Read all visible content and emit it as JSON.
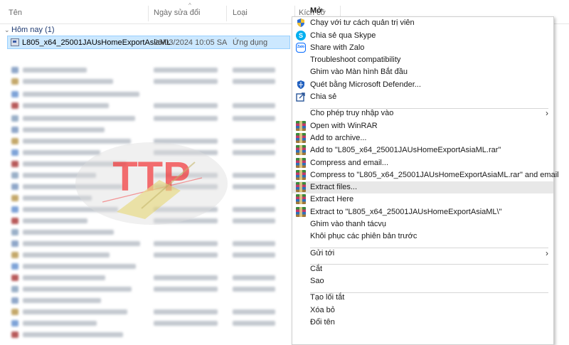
{
  "explorer": {
    "columns": [
      "Tên",
      "Ngày sửa đổi",
      "Loại",
      "Kích cỡ"
    ],
    "group_label": "Hôm nay (1)",
    "selected_file": {
      "name": "L805_x64_25001JAUsHomeExportAsiaML",
      "date": "26/03/2024 10:05 SA",
      "type": "Ứng dụng"
    }
  },
  "watermark": {
    "text": "TTP"
  },
  "context_menu": {
    "items": [
      {
        "label": "Mở",
        "icon": "none",
        "bold": true
      },
      {
        "label": "Chạy với tư cách quản trị viên",
        "icon": "uac-shield-icon"
      },
      {
        "label": "Chia sẻ qua Skype",
        "icon": "skype-icon"
      },
      {
        "label": "Share with Zalo",
        "icon": "zalo-icon"
      },
      {
        "label": "Troubleshoot compatibility",
        "icon": "none"
      },
      {
        "label": "Ghim vào Màn hình Bắt đầu",
        "icon": "none"
      },
      {
        "label": "Quét bằng Microsoft Defender...",
        "icon": "defender-icon"
      },
      {
        "label": "Chia sẻ",
        "icon": "share-icon"
      },
      {
        "label": "Cho phép truy nhập vào",
        "icon": "none",
        "submenu": true
      },
      {
        "label": "Open with WinRAR",
        "icon": "winrar-icon"
      },
      {
        "label": "Add to archive...",
        "icon": "winrar-icon"
      },
      {
        "label": "Add to \"L805_x64_25001JAUsHomeExportAsiaML.rar\"",
        "icon": "winrar-icon"
      },
      {
        "label": "Compress and email...",
        "icon": "winrar-icon"
      },
      {
        "label": "Compress to \"L805_x64_25001JAUsHomeExportAsiaML.rar\" and email",
        "icon": "winrar-icon"
      },
      {
        "label": "Extract files...",
        "icon": "winrar-icon",
        "highlighted": true
      },
      {
        "label": "Extract Here",
        "icon": "winrar-icon"
      },
      {
        "label": "Extract to \"L805_x64_25001JAUsHomeExportAsiaML\\\"",
        "icon": "winrar-icon"
      },
      {
        "label": "Ghim vào thanh tácvụ",
        "icon": "none"
      },
      {
        "label": "Khôi phục các phiên bản trước",
        "icon": "none"
      },
      {
        "label": "Gửi tới",
        "icon": "none",
        "submenu": true
      },
      {
        "label": "Cắt",
        "icon": "none"
      },
      {
        "label": "Sao",
        "icon": "none"
      },
      {
        "label": "Tạo lối tắt",
        "icon": "none"
      },
      {
        "label": "Xóa bỏ",
        "icon": "none"
      },
      {
        "label": "Đổi tên",
        "icon": "none"
      }
    ]
  },
  "colors": {
    "selection_bg": "#cce8ff",
    "selection_border": "#99d1ff",
    "menu_highlight": "#e8e8e8",
    "watermark_red": "#f0484a",
    "group_header": "#1f3b73"
  }
}
